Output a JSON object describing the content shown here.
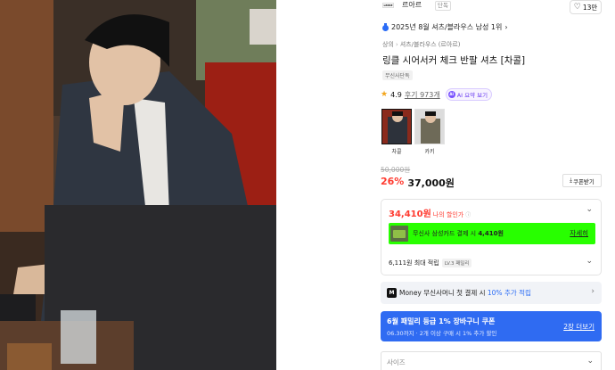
{
  "brand": {
    "logo_text": "LEMIE",
    "name": "르아르",
    "tag": "단독",
    "like_count": "13만"
  },
  "ranking": "2025년 8월 셔츠/블라우스 남성 1위",
  "breadcrumb": [
    "상의",
    "셔츠/블라우스",
    "(르아르)"
  ],
  "product": {
    "title": "링클 시어서커 체크 반팔 셔츠 [차콜]",
    "exclusive_badge": "무신사단독"
  },
  "reviews": {
    "rating": "4.9",
    "count_label": "후기 973개",
    "ai_label": "AI 요약 보기"
  },
  "colors": [
    {
      "label": "차콜",
      "selected": true
    },
    {
      "label": "카키",
      "selected": false
    }
  ],
  "price": {
    "original": "50,000원",
    "discount": "26%",
    "sale": "37,000원",
    "coupon_button": "쿠폰받기"
  },
  "promo": {
    "my_price": "34,410원",
    "my_price_label": "나의 할인가",
    "card_offer_prefix": "무신사 삼성카드 결제 시 ",
    "card_offer_amount": "4,410원",
    "detail_link": "자세히",
    "points": "6,111원 최대 적립",
    "level_badge": "LV.3 패밀리"
  },
  "money": {
    "text_prefix": "Money 무신사머니 첫 결제 시 ",
    "percent": "10% 추가 적립"
  },
  "coupon_banner": {
    "title": "6월 패밀리 등급 1% 장바구니 쿠폰",
    "subtitle": "06.30까지 · 2개 이상 구매 시 1% 추가 할인",
    "more": "2장 더보기"
  },
  "size_select": {
    "placeholder": "사이즈"
  },
  "colors_accent": {
    "discount_red": "#ff3b30",
    "card_green": "#28ff00",
    "coupon_blue": "#2f6bf2",
    "ai_purple": "#6a3df0"
  }
}
